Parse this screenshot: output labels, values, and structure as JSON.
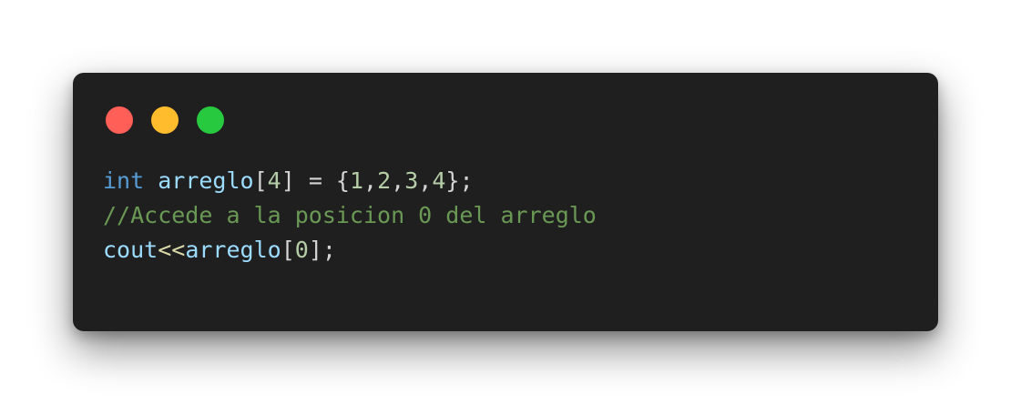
{
  "window_controls": [
    {
      "name": "close",
      "color": "#ff5f56"
    },
    {
      "name": "minimize",
      "color": "#ffbd2e"
    },
    {
      "name": "maximize",
      "color": "#27c93f"
    }
  ],
  "code": {
    "line1": {
      "keyword": "int",
      "space1": " ",
      "identifier": "arreglo",
      "open_bracket": "[",
      "size": "4",
      "close_bracket": "]",
      "assign": " = {",
      "v1": "1",
      "c1": ",",
      "v2": "2",
      "c2": ",",
      "v3": "3",
      "c3": ",",
      "v4": "4",
      "end": "};"
    },
    "line2": {
      "comment": "//Accede a la posicion 0 del arreglo"
    },
    "line3": {
      "object": "cout",
      "operator": "<<",
      "identifier": "arreglo",
      "open_bracket": "[",
      "index": "0",
      "close_bracket": "]",
      "end": ";"
    }
  },
  "colors": {
    "background": "#1f1f1f",
    "keyword": "#569cd6",
    "identifier": "#9cdcfe",
    "number": "#b5cea8",
    "comment": "#6a9955",
    "operator": "#dcdcaa",
    "punctuation": "#d4d4d4"
  }
}
